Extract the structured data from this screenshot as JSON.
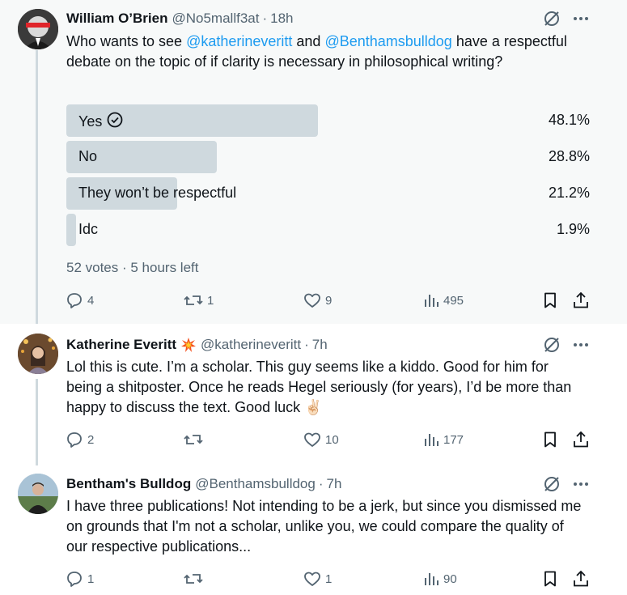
{
  "posts": [
    {
      "name": "William O’Brien",
      "handle": "@No5mallf3at",
      "time": "18h",
      "text_parts": [
        "Who wants to see ",
        "@katherineveritt",
        " and ",
        "@Benthamsbulldog",
        " have a respectful debate on the topic of if clarity is necessary in philosophical writing?"
      ],
      "poll": {
        "options": [
          {
            "label": "Yes",
            "percent_text": "48.1%",
            "fraction": 0.481,
            "selected": true
          },
          {
            "label": "No",
            "percent_text": "28.8%",
            "fraction": 0.288,
            "selected": false
          },
          {
            "label": "They won’t be respectful",
            "percent_text": "21.2%",
            "fraction": 0.212,
            "selected": false
          },
          {
            "label": "Idc",
            "percent_text": "1.9%",
            "fraction": 0.019,
            "selected": false
          }
        ],
        "meta": "52 votes · 5 hours left"
      },
      "stats": {
        "replies": "4",
        "reposts": "1",
        "likes": "9",
        "views": "495"
      }
    },
    {
      "name": "Katherine Everitt",
      "handle": "@katherineveritt",
      "time": "7h",
      "badge": "collision-emoji",
      "text": "Lol this is cute. I’m a scholar. This guy seems like a kiddo. Good for him for being a shitposter. Once he reads Hegel seriously (for years), I’d be more than happy to discuss the text. Good luck ✌🏻",
      "stats": {
        "replies": "2",
        "reposts": "",
        "likes": "10",
        "views": "177"
      }
    },
    {
      "name": "Bentham's Bulldog",
      "handle": "@Benthamsbulldog",
      "time": "7h",
      "text": "I have three publications!  Not intending to be a jerk, but since you dismissed me on grounds that I'm not a scholar, unlike you, we could compare the quality of our respective publications...",
      "stats": {
        "replies": "1",
        "reposts": "",
        "likes": "1",
        "views": "90"
      }
    }
  ],
  "separator": "·",
  "icons": {
    "grok": "grok-slash-circle-icon",
    "more": "more-horizontal-icon",
    "reply": "reply-bubble-icon",
    "repost": "repost-icon",
    "like": "heart-icon",
    "views": "bar-chart-icon",
    "bookmark": "bookmark-icon",
    "share": "share-icon",
    "poll_check": "check-circle-icon"
  },
  "colors": {
    "link": "#1d9bf0",
    "secondary_text": "#536471",
    "poll_bar": "#cfd9de",
    "thread_line": "#cfd9de",
    "hover_bg": "#f7f9f9"
  }
}
